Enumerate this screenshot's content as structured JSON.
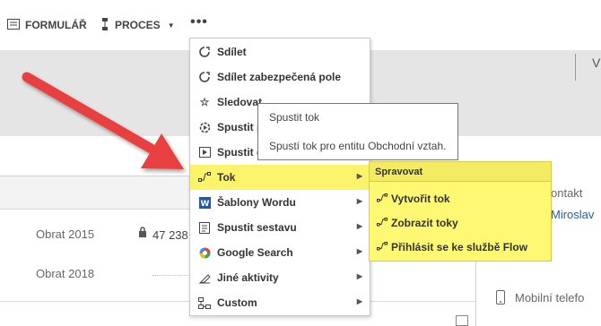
{
  "toolbar": {
    "form_label": "FORMULÁŘ",
    "process_label": "PROCES",
    "more_label": "•••"
  },
  "header_right": {
    "letter": "V"
  },
  "fields": [
    {
      "label": "Obrat 2015",
      "value": "47 238"
    },
    {
      "label": "Obrat 2018",
      "value": ""
    }
  ],
  "right_panel": {
    "contact_label": "ontakt",
    "contact_name": "Miroslav",
    "phone_label": "Mobilní telefo"
  },
  "menu": {
    "items": [
      {
        "label": "Sdílet",
        "icon": "share-icon"
      },
      {
        "label": "Sdílet zabezpečená pole",
        "icon": "share-secure-icon"
      },
      {
        "label": "Sledovat",
        "icon": "star-icon"
      },
      {
        "label": "Spustit pr",
        "icon": "run-process-icon"
      },
      {
        "label": "Spustit di",
        "icon": "run-dialog-icon"
      },
      {
        "label": "Tok",
        "icon": "flow-icon"
      },
      {
        "label": "Šablony Wordu",
        "icon": "word-icon"
      },
      {
        "label": "Spustit sestavu",
        "icon": "report-icon"
      },
      {
        "label": "Google Search",
        "icon": "google-icon"
      },
      {
        "label": "Jiné aktivity",
        "icon": "activity-icon"
      },
      {
        "label": "Custom",
        "icon": "custom-icon"
      }
    ]
  },
  "tooltip": {
    "title": "Spustit tok",
    "description": "Spustí tok pro entitu Obchodní vztah."
  },
  "submenu": {
    "header": "Spravovat",
    "items": [
      {
        "label": "Vytvořit tok"
      },
      {
        "label": "Zobrazit toky"
      },
      {
        "label": "Přihlásit se ke službě Flow"
      }
    ]
  },
  "colors": {
    "highlight": "#fbf46b",
    "arrow": "#e8413f"
  }
}
